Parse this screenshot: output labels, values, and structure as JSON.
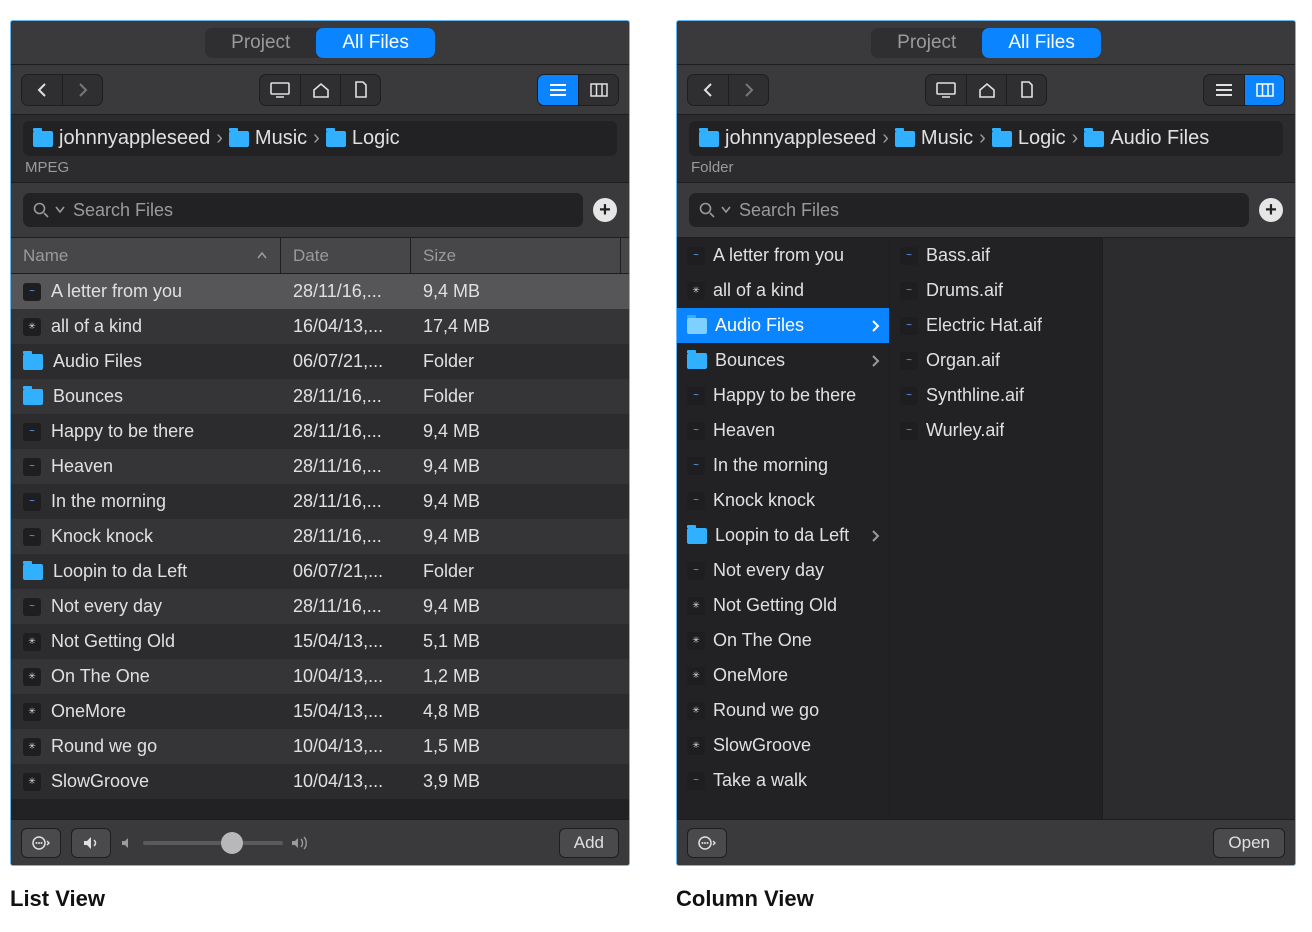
{
  "tabs": {
    "project_label": "Project",
    "allfiles_label": "All Files"
  },
  "search": {
    "placeholder": "Search Files"
  },
  "list_panel": {
    "breadcrumb": [
      {
        "label": "johnnyappleseed"
      },
      {
        "label": "Music"
      },
      {
        "label": "Logic"
      }
    ],
    "sub": "MPEG",
    "columns": {
      "name": "Name",
      "date": "Date",
      "size": "Size"
    },
    "rows": [
      {
        "name": "A letter from you",
        "date": "28/11/16,...",
        "size": "9,4 MB",
        "icon": "audio",
        "selected": true
      },
      {
        "name": "all of a kind",
        "date": "16/04/13,...",
        "size": "17,4 MB",
        "icon": "proj"
      },
      {
        "name": "Audio Files",
        "date": "06/07/21,...",
        "size": "Folder",
        "icon": "folder"
      },
      {
        "name": "Bounces",
        "date": "28/11/16,...",
        "size": "Folder",
        "icon": "folder"
      },
      {
        "name": "Happy to be there",
        "date": "28/11/16,...",
        "size": "9,4 MB",
        "icon": "audio"
      },
      {
        "name": "Heaven",
        "date": "28/11/16,...",
        "size": "9,4 MB",
        "icon": "audio"
      },
      {
        "name": "In the morning",
        "date": "28/11/16,...",
        "size": "9,4 MB",
        "icon": "audio"
      },
      {
        "name": "Knock knock",
        "date": "28/11/16,...",
        "size": "9,4 MB",
        "icon": "audio"
      },
      {
        "name": "Loopin to da Left",
        "date": "06/07/21,...",
        "size": "Folder",
        "icon": "folder"
      },
      {
        "name": "Not every day",
        "date": "28/11/16,...",
        "size": "9,4 MB",
        "icon": "audio"
      },
      {
        "name": "Not Getting Old",
        "date": "15/04/13,...",
        "size": "5,1 MB",
        "icon": "proj"
      },
      {
        "name": "On The One",
        "date": "10/04/13,...",
        "size": "1,2 MB",
        "icon": "proj"
      },
      {
        "name": "OneMore",
        "date": "15/04/13,...",
        "size": "4,8 MB",
        "icon": "proj"
      },
      {
        "name": "Round we go",
        "date": "10/04/13,...",
        "size": "1,5 MB",
        "icon": "proj"
      },
      {
        "name": "SlowGroove",
        "date": "10/04/13,...",
        "size": "3,9 MB",
        "icon": "proj"
      }
    ],
    "footer_btn": "Add",
    "caption": "List View"
  },
  "column_panel": {
    "breadcrumb": [
      {
        "label": "johnnyappleseed"
      },
      {
        "label": "Music"
      },
      {
        "label": "Logic"
      },
      {
        "label": "Audio Files"
      }
    ],
    "sub": "Folder",
    "col1": [
      {
        "name": "A letter from you",
        "icon": "audio"
      },
      {
        "name": "all of a kind",
        "icon": "proj"
      },
      {
        "name": "Audio Files",
        "icon": "folder",
        "hasChild": true,
        "selected": true
      },
      {
        "name": "Bounces",
        "icon": "folder",
        "hasChild": true
      },
      {
        "name": "Happy to be there",
        "icon": "audio"
      },
      {
        "name": "Heaven",
        "icon": "audio"
      },
      {
        "name": "In the morning",
        "icon": "audio"
      },
      {
        "name": "Knock knock",
        "icon": "audio"
      },
      {
        "name": "Loopin to da Left",
        "icon": "folder",
        "hasChild": true
      },
      {
        "name": "Not every day",
        "icon": "audio"
      },
      {
        "name": "Not Getting Old",
        "icon": "proj"
      },
      {
        "name": "On The One",
        "icon": "proj"
      },
      {
        "name": "OneMore",
        "icon": "proj"
      },
      {
        "name": "Round we go",
        "icon": "proj"
      },
      {
        "name": "SlowGroove",
        "icon": "proj"
      },
      {
        "name": "Take a walk",
        "icon": "audio"
      }
    ],
    "col2": [
      {
        "name": "Bass.aif",
        "icon": "audio"
      },
      {
        "name": "Drums.aif",
        "icon": "audio"
      },
      {
        "name": "Electric Hat.aif",
        "icon": "audio"
      },
      {
        "name": "Organ.aif",
        "icon": "audio"
      },
      {
        "name": "Synthline.aif",
        "icon": "audio"
      },
      {
        "name": "Wurley.aif",
        "icon": "audio"
      }
    ],
    "footer_btn": "Open",
    "caption": "Column View"
  }
}
